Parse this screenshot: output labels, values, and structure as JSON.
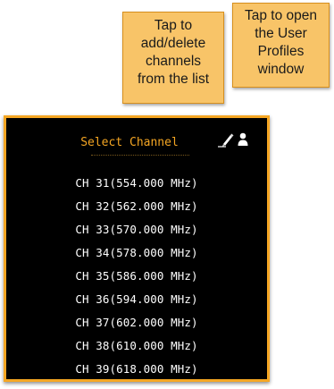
{
  "callouts": {
    "edit": "Tap to\nadd/delete\nchannels\nfrom the list",
    "profiles": "Tap to open\nthe User\nProfiles\nwindow"
  },
  "panel": {
    "title": "Select Channel",
    "edit_icon": "pencil-icon",
    "profile_icon": "user-icon",
    "accent_color": "#f5a623"
  },
  "channels": [
    "CH 31(554.000 MHz)",
    "CH 32(562.000 MHz)",
    "CH 33(570.000 MHz)",
    "CH 34(578.000 MHz)",
    "CH 35(586.000 MHz)",
    "CH 36(594.000 MHz)",
    "CH 37(602.000 MHz)",
    "CH 38(610.000 MHz)",
    "CH 39(618.000 MHz)"
  ]
}
